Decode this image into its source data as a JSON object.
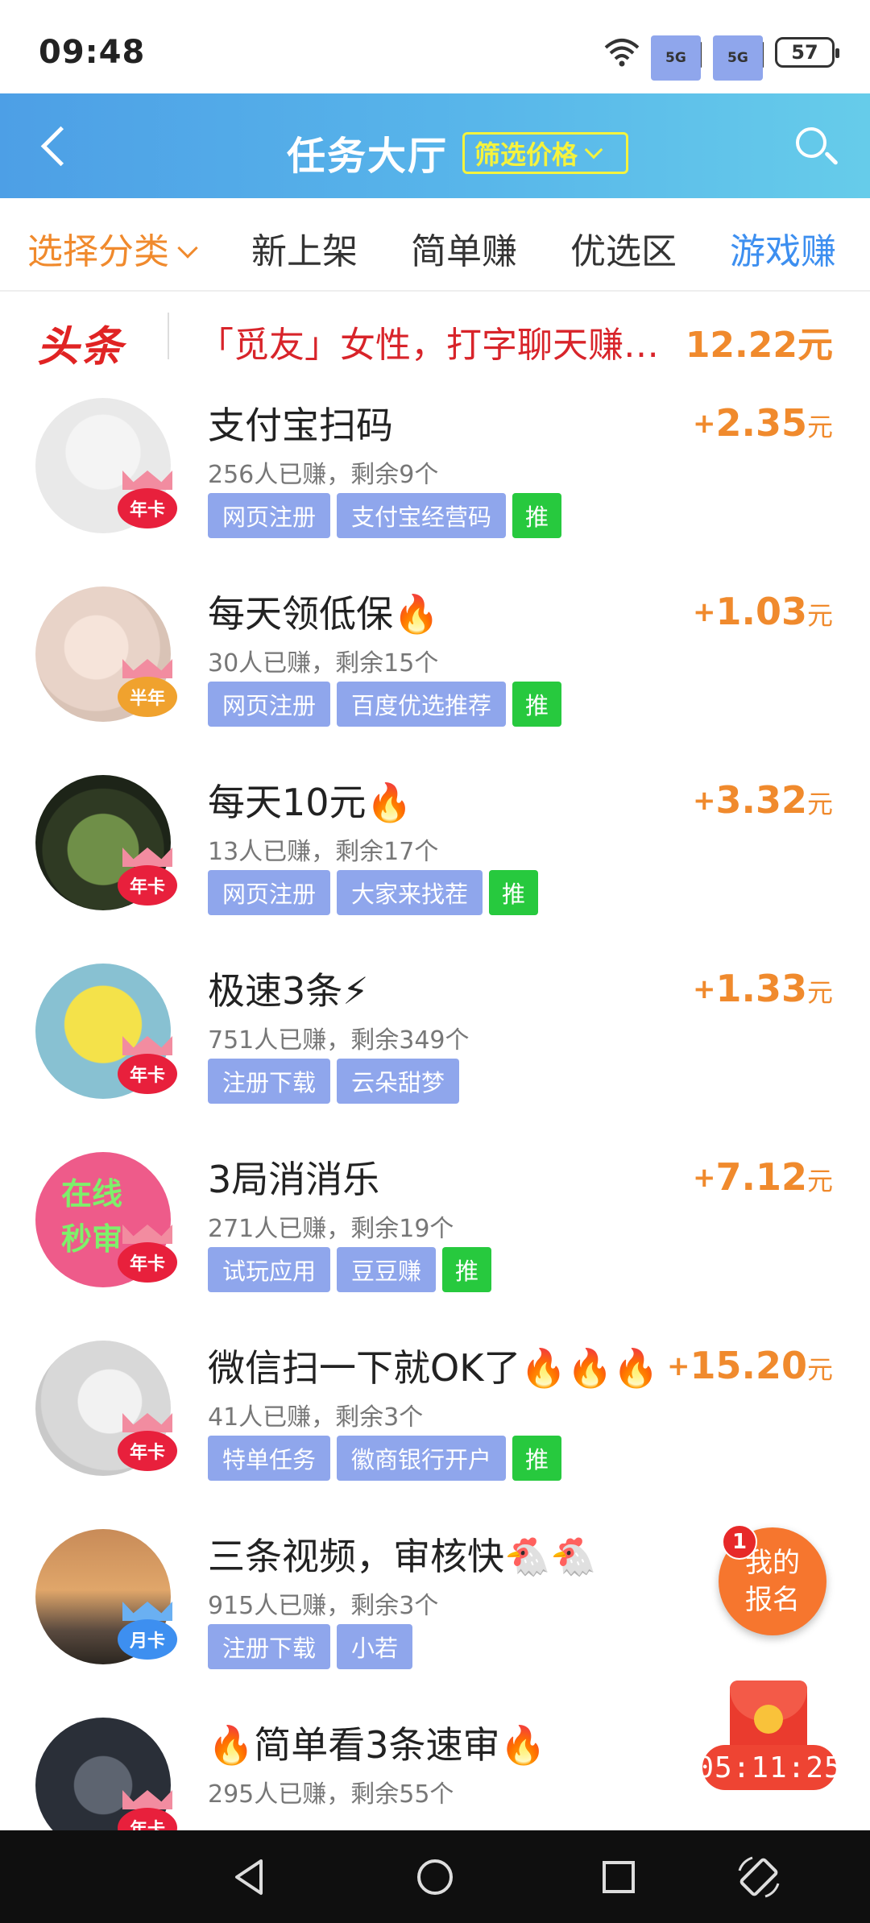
{
  "status_bar": {
    "time": "09:48",
    "network_1": "5G",
    "network_2": "5G",
    "battery": "57"
  },
  "header": {
    "title": "任务大厅",
    "filter_label": "筛选价格"
  },
  "categories": {
    "select_label": "选择分类",
    "items": [
      "新上架",
      "简单赚",
      "优选区",
      "游戏赚"
    ],
    "active_index": 3
  },
  "headline": {
    "badge": "头条",
    "text": "「觅友」女性，打字聊天赚…",
    "amount": "12.22元"
  },
  "tasks": [
    {
      "title": "支付宝扫码",
      "sub": "256人已赚，剩余9个",
      "price": "2.35",
      "tags": [
        "网页注册",
        "支付宝经营码"
      ],
      "rec": "推",
      "vip": "年卡"
    },
    {
      "title": "每天领低保🔥",
      "sub": "30人已赚，剩余15个",
      "price": "1.03",
      "tags": [
        "网页注册",
        "百度优选推荐"
      ],
      "rec": "推",
      "vip": "半年"
    },
    {
      "title": "每天10元🔥",
      "sub": "13人已赚，剩余17个",
      "price": "3.32",
      "tags": [
        "网页注册",
        "大家来找茬"
      ],
      "rec": "推",
      "vip": "年卡"
    },
    {
      "title": "极速3条⚡",
      "sub": "751人已赚，剩余349个",
      "price": "1.33",
      "tags": [
        "注册下载",
        "云朵甜梦"
      ],
      "rec": "",
      "vip": "年卡"
    },
    {
      "title": "3局消消乐",
      "sub": "271人已赚，剩余19个",
      "price": "7.12",
      "tags": [
        "试玩应用",
        "豆豆赚"
      ],
      "rec": "推",
      "vip": "年卡",
      "avatar_text": "在线秒审"
    },
    {
      "title": "微信扫一下就OK了🔥🔥🔥",
      "sub": "41人已赚，剩余3个",
      "price": "15.20",
      "tags": [
        "特单任务",
        "徽商银行开户"
      ],
      "rec": "推",
      "vip": "年卡"
    },
    {
      "title": "三条视频，审核快🐔🐔",
      "sub": "915人已赚，剩余3个",
      "price": "",
      "tags": [
        "注册下载",
        "小若"
      ],
      "rec": "",
      "vip": "月卡"
    },
    {
      "title": "🔥简单看3条速审🔥",
      "sub": "295人已赚，剩余55个",
      "price": "",
      "tags": [],
      "rec": "",
      "vip": "年卡"
    }
  ],
  "price_plus": "+",
  "price_unit": "元",
  "floating": {
    "my_signup_line1": "我的",
    "my_signup_line2": "报名",
    "badge_count": "1",
    "timer": "05:11:25"
  },
  "colors": {
    "header_start": "#4d9fe6",
    "header_end": "#66ccea",
    "accent_orange": "#f08a2d",
    "headline_red": "#d8242a",
    "tag_blue": "#8fa6ec",
    "tag_green": "#27c93e",
    "active_blue": "#3d8ff0"
  },
  "icons": {
    "back": "chevron-left-icon",
    "search": "search-icon",
    "dropdown": "chevron-down-icon",
    "nav_back": "triangle-back-icon",
    "nav_home": "circle-home-icon",
    "nav_recent": "square-recent-icon",
    "nav_rotate": "rotate-icon"
  }
}
